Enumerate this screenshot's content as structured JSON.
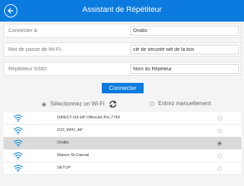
{
  "header": {
    "title": "Assistant de Répétiteur",
    "back_icon": "back-arrow-circle-icon"
  },
  "form": {
    "connect_to": {
      "label": "Connecter à:",
      "value": "Ondilo"
    },
    "wifi_password": {
      "label": "Mot de passe de Wi-Fi:",
      "value": "clé de sécurité wifi de la box"
    },
    "ssid": {
      "label": "Répétiteur SSID:",
      "value": "Nom du Répéteur"
    }
  },
  "connect_button": "Connecter",
  "mode": {
    "select_wifi": {
      "label": "Sélectionnez un Wi-Fi",
      "selected": true
    },
    "manual": {
      "label": "Entrez manuellement",
      "selected": false
    }
  },
  "networks": [
    {
      "name": "DIRECT-D9-HP OfficeJet Pro 7740",
      "selected": false,
      "signal_color": "#1a8fe3"
    },
    {
      "name": "ICO_WIFI_AP",
      "selected": false,
      "signal_color": "#1a8fe3"
    },
    {
      "name": "Ondilo",
      "selected": true,
      "signal_color": "#1a8fe3"
    },
    {
      "name": "Manon St-Cannat",
      "selected": false,
      "signal_color": "#1a8fe3"
    },
    {
      "name": "SETUP",
      "selected": false,
      "signal_color": "#1a8fe3"
    }
  ],
  "colors": {
    "accent": "#0b7be0",
    "selected_row": "#d9d9d9"
  }
}
